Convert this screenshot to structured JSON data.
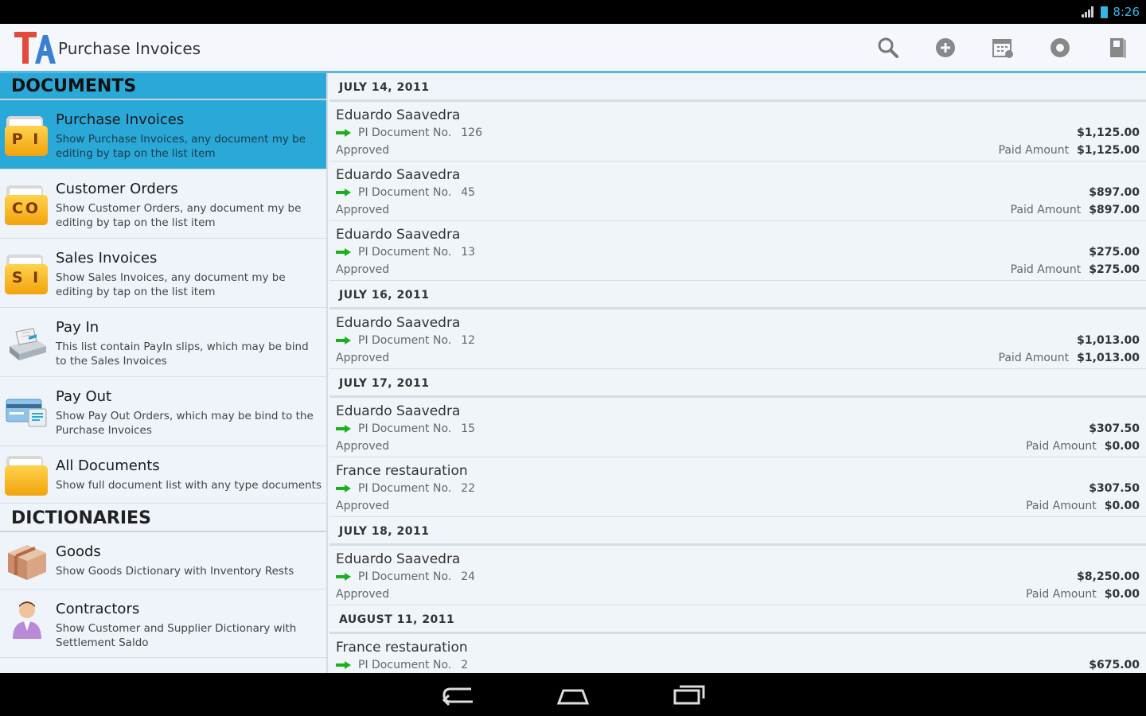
{
  "status_bar": {
    "time": "8:26"
  },
  "app": {
    "title": "Purchase Invoices"
  },
  "action_bar": {
    "icons": [
      "search-icon",
      "add-icon",
      "calendar-icon",
      "settings-icon",
      "exit-icon"
    ]
  },
  "sidebar": {
    "documents_heading": "DOCUMENTS",
    "documents": [
      {
        "code": "P I",
        "title": "Purchase Invoices",
        "desc": "Show Purchase Invoices, any document my be editing by tap on the list item",
        "active": true
      },
      {
        "code": "CO",
        "title": "Customer Orders",
        "desc": "Show Customer Orders, any document my be editing by tap on the list item"
      },
      {
        "code": "S I",
        "title": "Sales Invoices",
        "desc": "Show Sales Invoices, any document my be editing by tap on the list item"
      },
      {
        "title": "Pay In",
        "desc": "This list contain PayIn slips, which may be bind to the Sales Invoices",
        "icon": "cash-register-icon"
      },
      {
        "title": "Pay Out",
        "desc": "Show Pay Out Orders, which may be bind to the Purchase Invoices",
        "icon": "bank-card-icon"
      },
      {
        "code": "",
        "title": "All Documents",
        "desc": "Show full document list with any type documents"
      }
    ],
    "dictionaries_heading": "DICTIONARIES",
    "dictionaries": [
      {
        "title": "Goods",
        "desc": "Show Goods Dictionary with Inventory Rests",
        "icon": "box-icon"
      },
      {
        "title": "Contractors",
        "desc": "Show Customer and Supplier Dictionary with Settlement Saldo",
        "icon": "person-icon"
      }
    ]
  },
  "list": {
    "doc_label": "PI  Document No.",
    "paid_label": "Paid Amount",
    "groups": [
      {
        "date": "JULY 14, 2011",
        "rows": [
          {
            "name": "Eduardo Saavedra",
            "no": "126",
            "status": "Approved",
            "amount": "$1,125.00",
            "paid": "$1,125.00"
          },
          {
            "name": "Eduardo Saavedra",
            "no": "45",
            "status": "Approved",
            "amount": "$897.00",
            "paid": "$897.00"
          },
          {
            "name": "Eduardo Saavedra",
            "no": "13",
            "status": "Approved",
            "amount": "$275.00",
            "paid": "$275.00"
          }
        ]
      },
      {
        "date": "JULY 16, 2011",
        "rows": [
          {
            "name": "Eduardo Saavedra",
            "no": "12",
            "status": "Approved",
            "amount": "$1,013.00",
            "paid": "$1,013.00"
          }
        ]
      },
      {
        "date": "JULY 17, 2011",
        "rows": [
          {
            "name": "Eduardo Saavedra",
            "no": "15",
            "status": "Approved",
            "amount": "$307.50",
            "paid": "$0.00"
          },
          {
            "name": "France restauration",
            "no": "22",
            "status": "Approved",
            "amount": "$307.50",
            "paid": "$0.00"
          }
        ]
      },
      {
        "date": "JULY 18, 2011",
        "rows": [
          {
            "name": "Eduardo Saavedra",
            "no": "24",
            "status": "Approved",
            "amount": "$8,250.00",
            "paid": "$0.00"
          }
        ]
      },
      {
        "date": "AUGUST 11, 2011",
        "rows": [
          {
            "name": "France restauration",
            "no": "2",
            "status": "",
            "amount": "$675.00",
            "paid": ""
          }
        ]
      }
    ]
  },
  "nav_bar": {
    "icons": [
      "back-icon",
      "home-icon",
      "recents-icon"
    ]
  },
  "colors": {
    "accent": "#2aa8d8",
    "arrow": "#1bb01b",
    "folder": "#f2a20c"
  }
}
